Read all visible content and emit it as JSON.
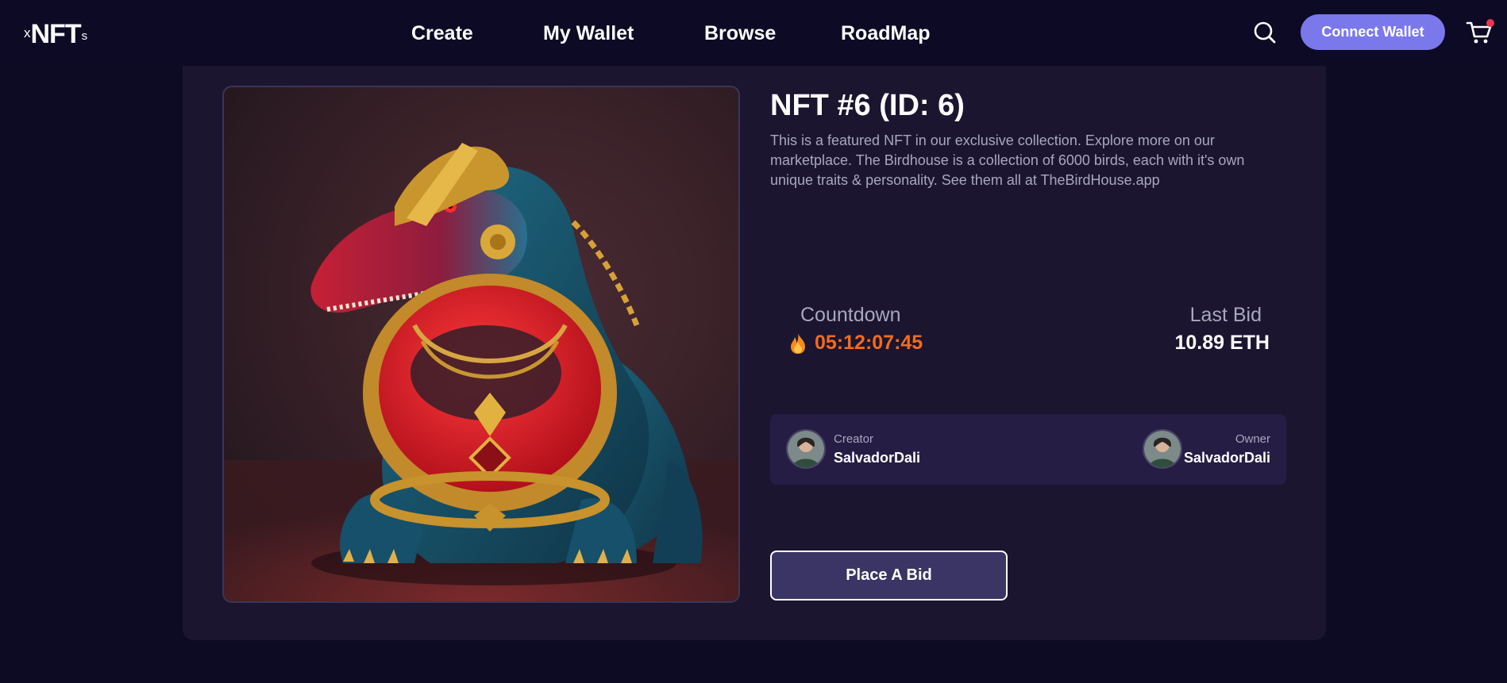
{
  "header": {
    "logo": {
      "prefix": "x",
      "main": "NFT",
      "suffix": "s"
    },
    "nav": [
      {
        "label": "Create"
      },
      {
        "label": "My Wallet"
      },
      {
        "label": "Browse"
      },
      {
        "label": "RoadMap"
      }
    ],
    "search_icon": "search-icon",
    "connect_label": "Connect Wallet",
    "cart_icon": "cart-icon",
    "cart_has_notification": true
  },
  "nft": {
    "title": "NFT #6 (ID: 6)",
    "description": "This is a featured NFT in our exclusive collection. Explore more on our marketplace. The Birdhouse is a collection of 6000 birds, each with it's own unique traits & personality. See them all at TheBirdHouse.app",
    "artwork_icon": "dinosaur-artwork",
    "countdown_label": "Countdown",
    "countdown_value": "05:12:07:45",
    "last_bid_label": "Last Bid",
    "last_bid_value": "10.89 ETH",
    "creator_role": "Creator",
    "creator_name": "SalvadorDali",
    "owner_role": "Owner",
    "owner_name": "SalvadorDali",
    "bid_button": "Place A Bid"
  },
  "colors": {
    "page_bg": "#0d0b24",
    "card_bg": "#1b1530",
    "accent": "#7b78ec",
    "countdown": "#f26b1d",
    "people_bg": "#261d45",
    "bid_bg": "#3b3566"
  }
}
